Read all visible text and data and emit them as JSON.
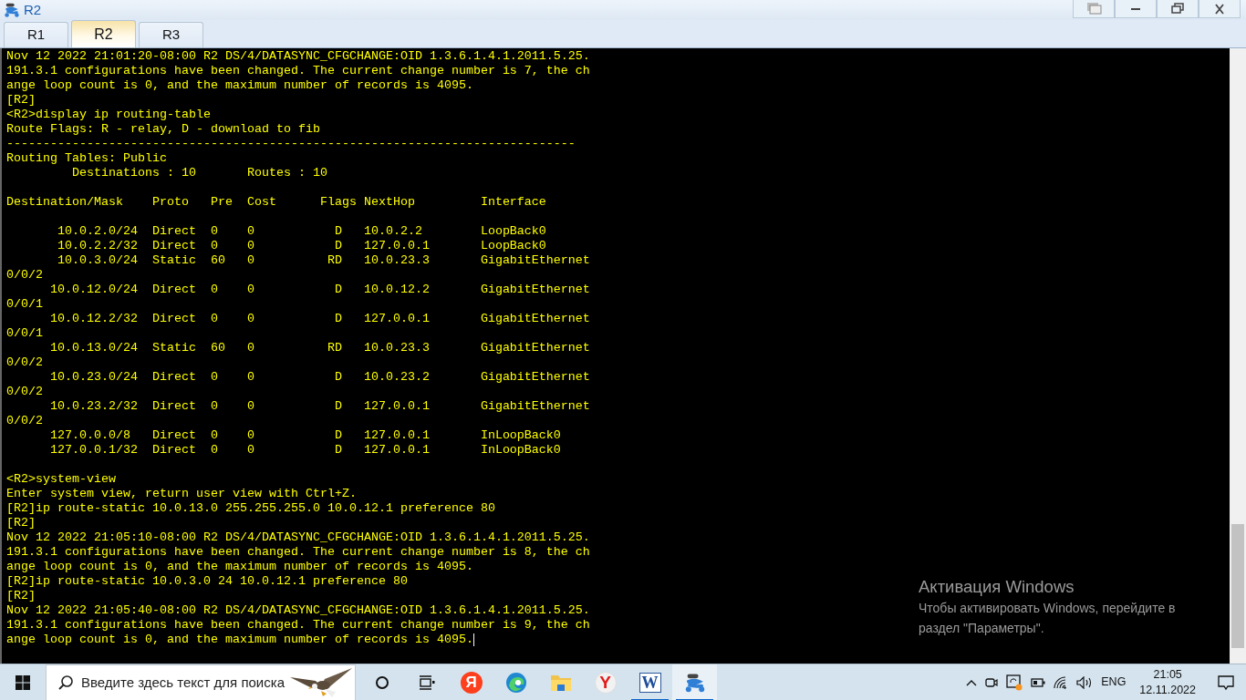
{
  "window": {
    "title": "R2"
  },
  "tabs": [
    {
      "label": "R1",
      "selected": false
    },
    {
      "label": "R2",
      "selected": true
    },
    {
      "label": "R3",
      "selected": false
    }
  ],
  "terminal": {
    "cursor": true,
    "lines": [
      {
        "kind": "text",
        "text": "Nov 12 2022 21:01:20-08:00 R2 DS/4/DATASYNC_CFGCHANGE:OID 1.3.6.1.4.1.2011.5.25."
      },
      {
        "kind": "text",
        "text": "191.3.1 configurations have been changed. The current change number is 7, the ch"
      },
      {
        "kind": "text",
        "text": "ange loop count is 0, and the maximum number of records is 4095."
      },
      {
        "kind": "text",
        "text": "[R2]"
      },
      {
        "kind": "text",
        "text": "<R2>display ip routing-table"
      },
      {
        "kind": "text",
        "text": "Route Flags: R - relay, D - download to fib"
      },
      {
        "kind": "text",
        "text": "------------------------------------------------------------------------------"
      },
      {
        "kind": "text",
        "text": "Routing Tables: Public"
      },
      {
        "kind": "text",
        "text": "         Destinations : 10       Routes : 10"
      },
      {
        "kind": "blank"
      },
      {
        "kind": "text",
        "text": "Destination/Mask    Proto   Pre  Cost      Flags NextHop         Interface"
      },
      {
        "kind": "blank"
      },
      {
        "kind": "text",
        "text": "       10.0.2.0/24  Direct  0    0           D   10.0.2.2        LoopBack0"
      },
      {
        "kind": "text",
        "text": "       10.0.2.2/32  Direct  0    0           D   127.0.0.1       LoopBack0"
      },
      {
        "kind": "text",
        "text": "       10.0.3.0/24  Static  60   0          RD   10.0.23.3       GigabitEthernet"
      },
      {
        "kind": "text",
        "text": "0/0/2"
      },
      {
        "kind": "text",
        "text": "      10.0.12.0/24  Direct  0    0           D   10.0.12.2       GigabitEthernet"
      },
      {
        "kind": "text",
        "text": "0/0/1"
      },
      {
        "kind": "text",
        "text": "      10.0.12.2/32  Direct  0    0           D   127.0.0.1       GigabitEthernet"
      },
      {
        "kind": "text",
        "text": "0/0/1"
      },
      {
        "kind": "text",
        "text": "      10.0.13.0/24  Static  60   0          RD   10.0.23.3       GigabitEthernet"
      },
      {
        "kind": "text",
        "text": "0/0/2"
      },
      {
        "kind": "text",
        "text": "      10.0.23.0/24  Direct  0    0           D   10.0.23.2       GigabitEthernet"
      },
      {
        "kind": "text",
        "text": "0/0/2"
      },
      {
        "kind": "text",
        "text": "      10.0.23.2/32  Direct  0    0           D   127.0.0.1       GigabitEthernet"
      },
      {
        "kind": "text",
        "text": "0/0/2"
      },
      {
        "kind": "text",
        "text": "      127.0.0.0/8   Direct  0    0           D   127.0.0.1       InLoopBack0"
      },
      {
        "kind": "text",
        "text": "      127.0.0.1/32  Direct  0    0           D   127.0.0.1       InLoopBack0"
      },
      {
        "kind": "blank"
      },
      {
        "kind": "text",
        "text": "<R2>system-view"
      },
      {
        "kind": "text",
        "text": "Enter system view, return user view with Ctrl+Z."
      },
      {
        "kind": "text",
        "text": "[R2]ip route-static 10.0.13.0 255.255.255.0 10.0.12.1 preference 80"
      },
      {
        "kind": "text",
        "text": "[R2]"
      },
      {
        "kind": "text",
        "text": "Nov 12 2022 21:05:10-08:00 R2 DS/4/DATASYNC_CFGCHANGE:OID 1.3.6.1.4.1.2011.5.25."
      },
      {
        "kind": "text",
        "text": "191.3.1 configurations have been changed. The current change number is 8, the ch"
      },
      {
        "kind": "text",
        "text": "ange loop count is 0, and the maximum number of records is 4095."
      },
      {
        "kind": "text",
        "text": "[R2]ip route-static 10.0.3.0 24 10.0.12.1 preference 80"
      },
      {
        "kind": "text",
        "text": "[R2]"
      },
      {
        "kind": "text",
        "text": "Nov 12 2022 21:05:40-08:00 R2 DS/4/DATASYNC_CFGCHANGE:OID 1.3.6.1.4.1.2011.5.25."
      },
      {
        "kind": "text",
        "text": "191.3.1 configurations have been changed. The current change number is 9, the ch"
      },
      {
        "kind": "text",
        "text": "ange loop count is 0, and the maximum number of records is 4095."
      }
    ]
  },
  "activation_notice": {
    "title": "Активация Windows",
    "lines": [
      "Чтобы активировать Windows, перейдите в",
      "раздел \"Параметры\"."
    ]
  },
  "taskbar": {
    "search": {
      "placeholder": "Введите здесь текст для поиска"
    },
    "apps": [
      {
        "kind": "yandex",
        "glyph": "Я",
        "running": false,
        "selected": false
      },
      {
        "kind": "edge",
        "running": false,
        "selected": false
      },
      {
        "kind": "explorer",
        "running": false,
        "selected": false
      },
      {
        "kind": "browser",
        "glyph": "Y",
        "running": false,
        "selected": false
      },
      {
        "kind": "word",
        "glyph": "W",
        "running": true,
        "selected": false
      },
      {
        "kind": "ensp",
        "running": true,
        "selected": true
      }
    ],
    "tray": {
      "language": "ENG",
      "time": "21:05",
      "date": "12.11.2022"
    }
  }
}
